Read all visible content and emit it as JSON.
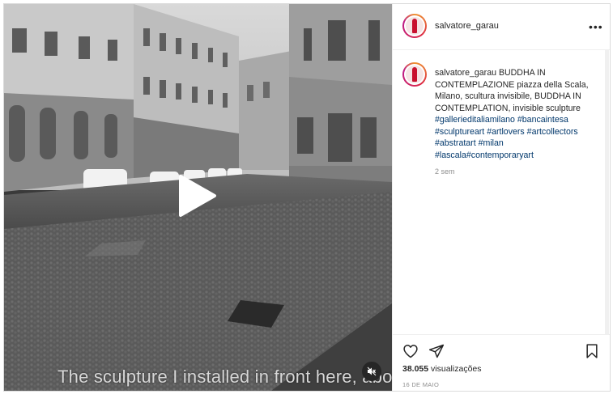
{
  "post": {
    "username": "salvatore_garau",
    "more_label": "•••",
    "caption_user": "salvatore_garau",
    "caption_text": "BUDDHA IN CONTEMPLAZIONE piazza della Scala, Milano, scultura invisibile, BUDDHA IN CONTEMPLATION, invisible sculpture ",
    "hashtags": [
      "#gallerieditaliamilano",
      "#bancaintesa",
      "#sculptureart",
      "#artlovers",
      "#artcollectors",
      "#abstratart",
      "#milan",
      "#lascala",
      "#contemporaryart"
    ],
    "time_ago": "2 sem",
    "views_count": "38.055",
    "views_label": "visualizações",
    "date": "16 DE MAIO"
  },
  "video": {
    "subtitle": "The sculpture I installed in front here, abo"
  },
  "icons": {
    "play": "play-icon",
    "mute": "muted-speaker-icon",
    "like": "heart-icon",
    "share": "paper-plane-icon",
    "save": "bookmark-icon",
    "more": "ellipsis-icon"
  }
}
